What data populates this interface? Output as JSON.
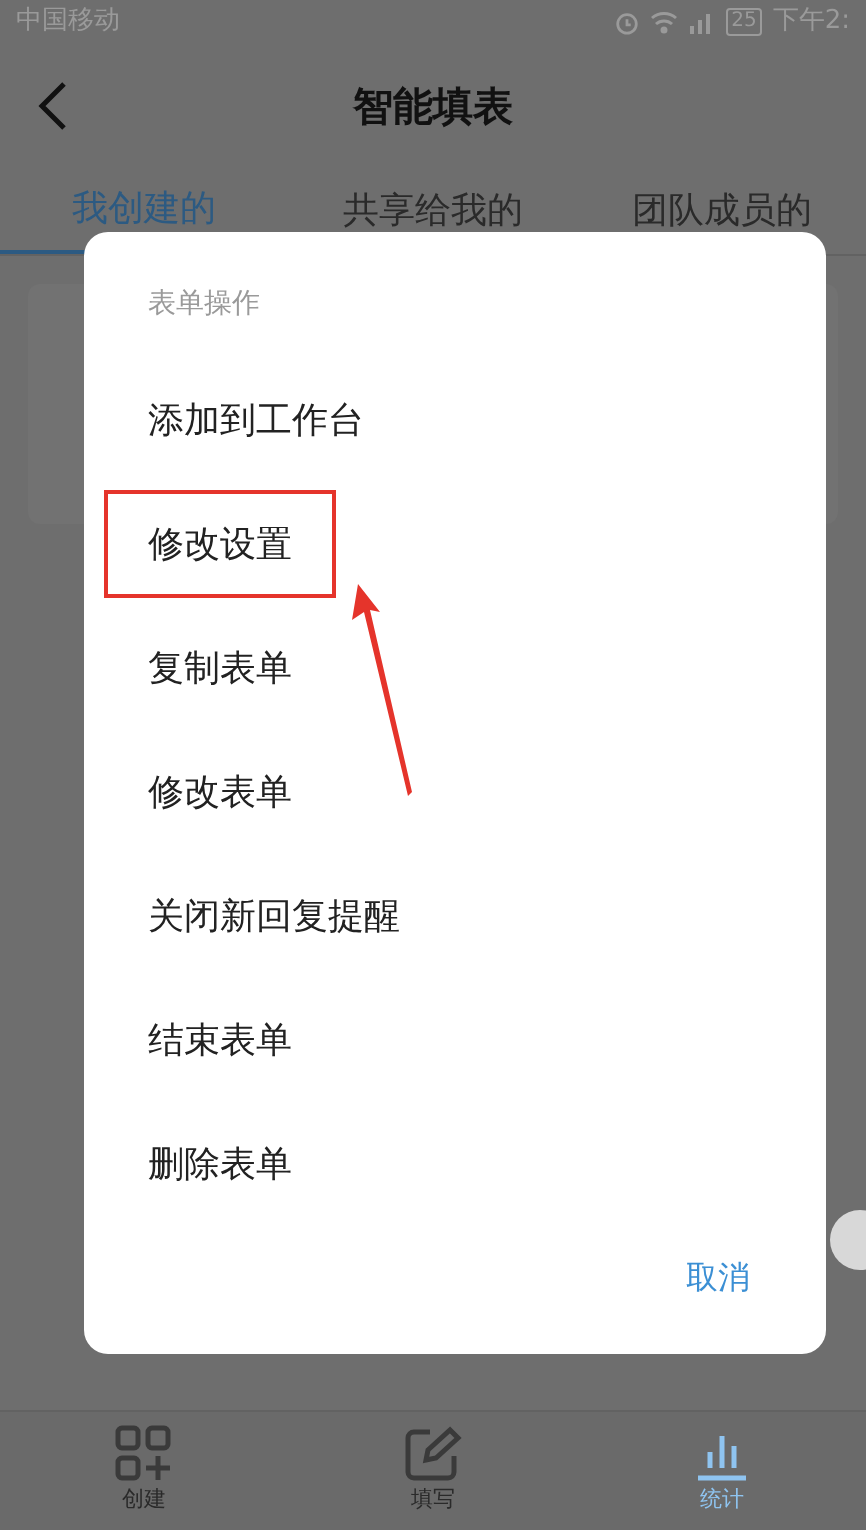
{
  "status_bar": {
    "carrier": "中国移动",
    "battery": "25",
    "time": "下午2:"
  },
  "header": {
    "title": "智能填表"
  },
  "tabs": [
    {
      "label": "我创建的",
      "selected": true
    },
    {
      "label": "共享给我的",
      "selected": false
    },
    {
      "label": "团队成员的",
      "selected": false
    }
  ],
  "dialog": {
    "title": "表单操作",
    "items": [
      {
        "label": "添加到工作台",
        "annotated": false
      },
      {
        "label": "修改设置",
        "annotated": true
      },
      {
        "label": "复制表单",
        "annotated": false
      },
      {
        "label": "修改表单",
        "annotated": false
      },
      {
        "label": "关闭新回复提醒",
        "annotated": false
      },
      {
        "label": "结束表单",
        "annotated": false
      },
      {
        "label": "删除表单",
        "annotated": false
      }
    ],
    "cancel": "取消"
  },
  "bottom_nav": [
    {
      "label": "创建",
      "kind": "create",
      "selected": false
    },
    {
      "label": "填写",
      "kind": "fill",
      "selected": false
    },
    {
      "label": "统计",
      "kind": "stats",
      "selected": true
    }
  ]
}
